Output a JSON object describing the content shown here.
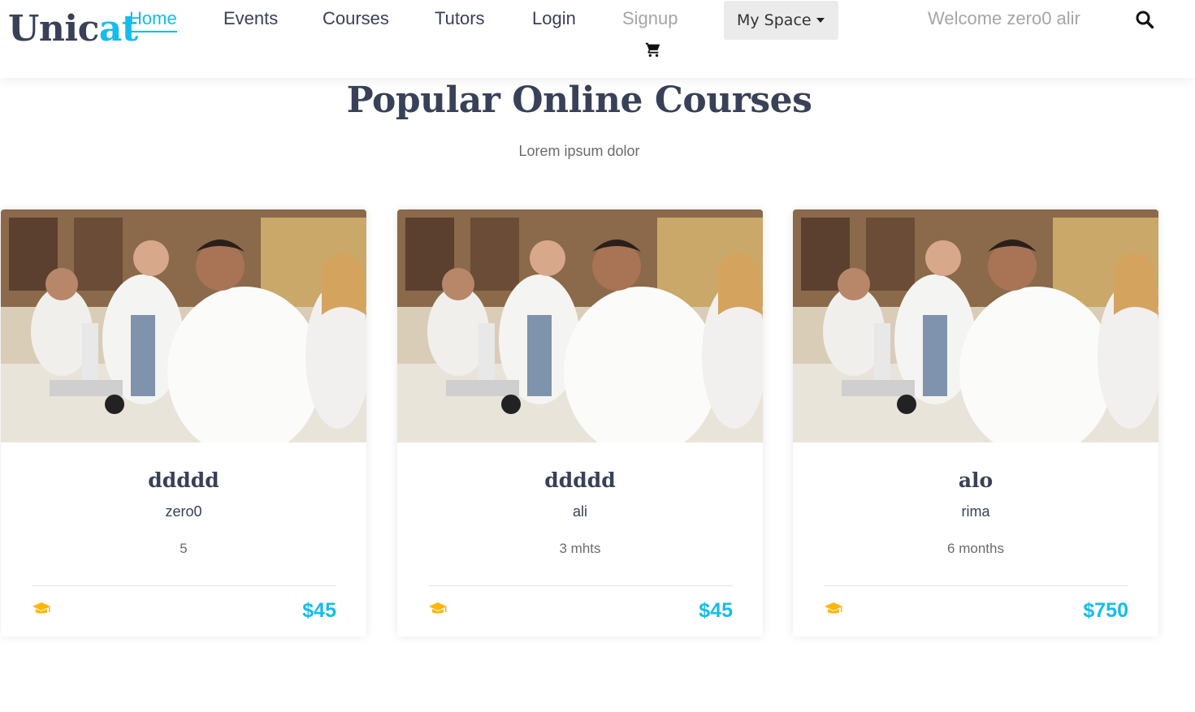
{
  "header": {
    "logo_main": "Unic",
    "logo_accent": "at",
    "nav": {
      "home": "Home",
      "events": "Events",
      "courses": "Courses",
      "tutors": "Tutors",
      "login": "Login",
      "signup": "Signup"
    },
    "dropdown_label": "My Space",
    "welcome_text": "Welcome zero0 alir",
    "cart_icon": "shopping-cart-icon",
    "search_icon": "search-icon"
  },
  "section": {
    "title": "Popular Online Courses",
    "subtitle": "Lorem ipsum dolor"
  },
  "courses": [
    {
      "title": "ddddd",
      "author": "zero0",
      "duration": "5",
      "price": "$45"
    },
    {
      "title": "ddddd",
      "author": "ali",
      "duration": "3 mhts",
      "price": "$45"
    },
    {
      "title": "alo",
      "author": "rima",
      "duration": "6 months",
      "price": "$750"
    }
  ],
  "colors": {
    "accent": "#14bdee",
    "heading": "#384158",
    "muted": "#a5a5a5",
    "cap_icon": "#ffb606"
  }
}
